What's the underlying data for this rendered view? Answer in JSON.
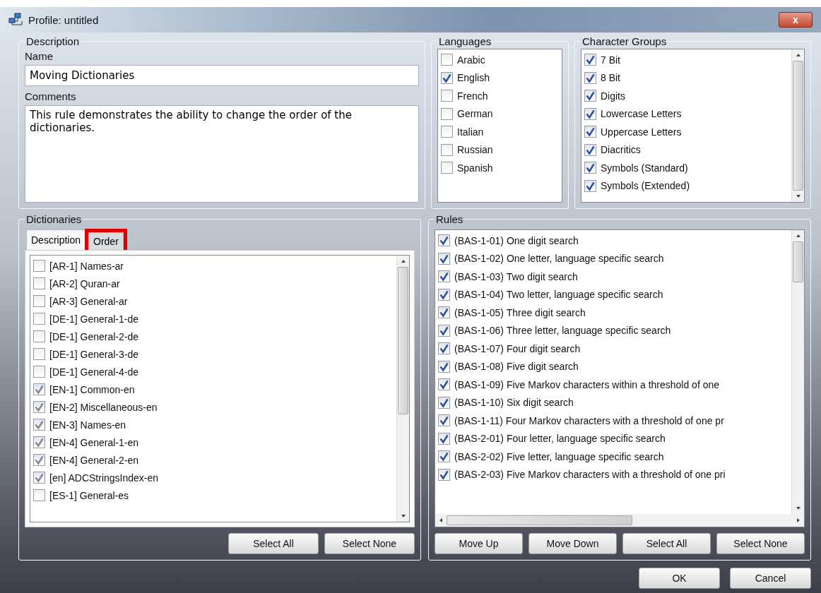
{
  "window": {
    "title": "Profile: untitled",
    "close_label": "x"
  },
  "description": {
    "title": "Description",
    "name_label": "Name",
    "name_value": "Moving Dictionaries",
    "comments_label": "Comments",
    "comments_value": "This rule demonstrates the ability to change the order of the dictionaries."
  },
  "languages": {
    "title": "Languages",
    "items": [
      {
        "label": "Arabic",
        "checked": false
      },
      {
        "label": "English",
        "checked": true
      },
      {
        "label": "French",
        "checked": false
      },
      {
        "label": "German",
        "checked": false
      },
      {
        "label": "Italian",
        "checked": false
      },
      {
        "label": "Russian",
        "checked": false
      },
      {
        "label": "Spanish",
        "checked": false
      }
    ]
  },
  "character_groups": {
    "title": "Character Groups",
    "items": [
      {
        "label": "7 Bit",
        "checked": true
      },
      {
        "label": "8 Bit",
        "checked": true
      },
      {
        "label": "Digits",
        "checked": true
      },
      {
        "label": "Lowercase Letters",
        "checked": true
      },
      {
        "label": "Uppercase Letters",
        "checked": true
      },
      {
        "label": "Diacritics",
        "checked": true
      },
      {
        "label": "Symbols (Standard)",
        "checked": true
      },
      {
        "label": "Symbols (Extended)",
        "checked": true
      }
    ]
  },
  "dictionaries": {
    "title": "Dictionaries",
    "tabs": [
      {
        "label": "Description",
        "selected": true,
        "highlighted": false
      },
      {
        "label": "Order",
        "selected": false,
        "highlighted": true
      }
    ],
    "items": [
      {
        "label": "[AR-1] Names-ar",
        "checked": false
      },
      {
        "label": "[AR-2] Quran-ar",
        "checked": false
      },
      {
        "label": "[AR-3] General-ar",
        "checked": false
      },
      {
        "label": "[DE-1] General-1-de",
        "checked": false
      },
      {
        "label": "[DE-1] General-2-de",
        "checked": false
      },
      {
        "label": "[DE-1] General-3-de",
        "checked": false
      },
      {
        "label": "[DE-1] General-4-de",
        "checked": false
      },
      {
        "label": "[EN-1] Common-en",
        "checked": true
      },
      {
        "label": "[EN-2] Miscellaneous-en",
        "checked": true
      },
      {
        "label": "[EN-3] Names-en",
        "checked": true
      },
      {
        "label": "[EN-4] General-1-en",
        "checked": true
      },
      {
        "label": "[EN-4] General-2-en",
        "checked": true
      },
      {
        "label": "[en] ADCStringsIndex-en",
        "checked": true
      },
      {
        "label": "[ES-1] General-es",
        "checked": false
      }
    ],
    "buttons": [
      "Select All",
      "Select None"
    ]
  },
  "rules": {
    "title": "Rules",
    "items": [
      {
        "label": "(BAS-1-01) One digit search",
        "checked": true
      },
      {
        "label": "(BAS-1-02) One letter, language specific search",
        "checked": true
      },
      {
        "label": "(BAS-1-03) Two digit search",
        "checked": true
      },
      {
        "label": "(BAS-1-04) Two letter, language specific search",
        "checked": true
      },
      {
        "label": "(BAS-1-05) Three digit search",
        "checked": true
      },
      {
        "label": "(BAS-1-06) Three letter, language specific search",
        "checked": true
      },
      {
        "label": "(BAS-1-07) Four digit search",
        "checked": true
      },
      {
        "label": "(BAS-1-08) Five digit search",
        "checked": true
      },
      {
        "label": "(BAS-1-09) Five Markov characters within a threshold of one",
        "checked": true
      },
      {
        "label": "(BAS-1-10) Six digit search",
        "checked": true
      },
      {
        "label": "(BAS-1-11) Four Markov characters with a threshold of one pr",
        "checked": true
      },
      {
        "label": "(BAS-2-01) Four letter, language specific search",
        "checked": true
      },
      {
        "label": "(BAS-2-02) Five letter, language specific search",
        "checked": true
      },
      {
        "label": "(BAS-2-03) Five Markov characters with a threshold of one pri",
        "checked": true
      }
    ],
    "buttons": [
      "Move Up",
      "Move Down",
      "Select All",
      "Select None"
    ]
  },
  "buttons": [
    "OK",
    "Cancel"
  ]
}
